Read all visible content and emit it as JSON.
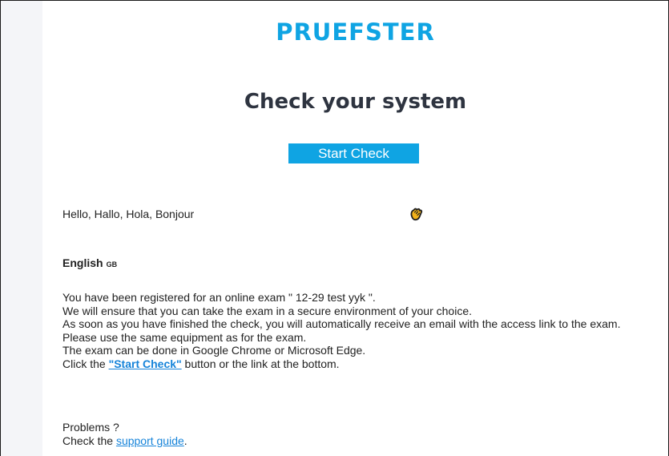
{
  "header": {
    "brand": "PRUEFSTER"
  },
  "main": {
    "title": "Check your system",
    "start_check_label": "Start Check",
    "greeting": "Hello, Hallo, Hola, Bonjour",
    "greeting_icon": "waving-hand-icon"
  },
  "english": {
    "heading": "English",
    "badge": "GB",
    "lines": [
      "You have been registered for an online exam \" 12-29 test yyk \".",
      "We will ensure that you can take the exam in a secure environment of your choice.",
      "As soon as you have finished the check, you will automatically receive an email with the access link to the exam.",
      "Please use the same equipment as for the exam.",
      "The exam can be done in Google Chrome or Microsoft Edge."
    ],
    "click_prefix": "Click the ",
    "click_link": "\"Start Check\"",
    "click_suffix": " button or the link at the bottom."
  },
  "support": {
    "problems": "Problems ?",
    "check_prefix": "Check the ",
    "link_label": "support guide",
    "check_suffix": "."
  },
  "colors": {
    "accent": "#0fa4e3",
    "heading": "#2e3440",
    "link": "#1583d9"
  }
}
